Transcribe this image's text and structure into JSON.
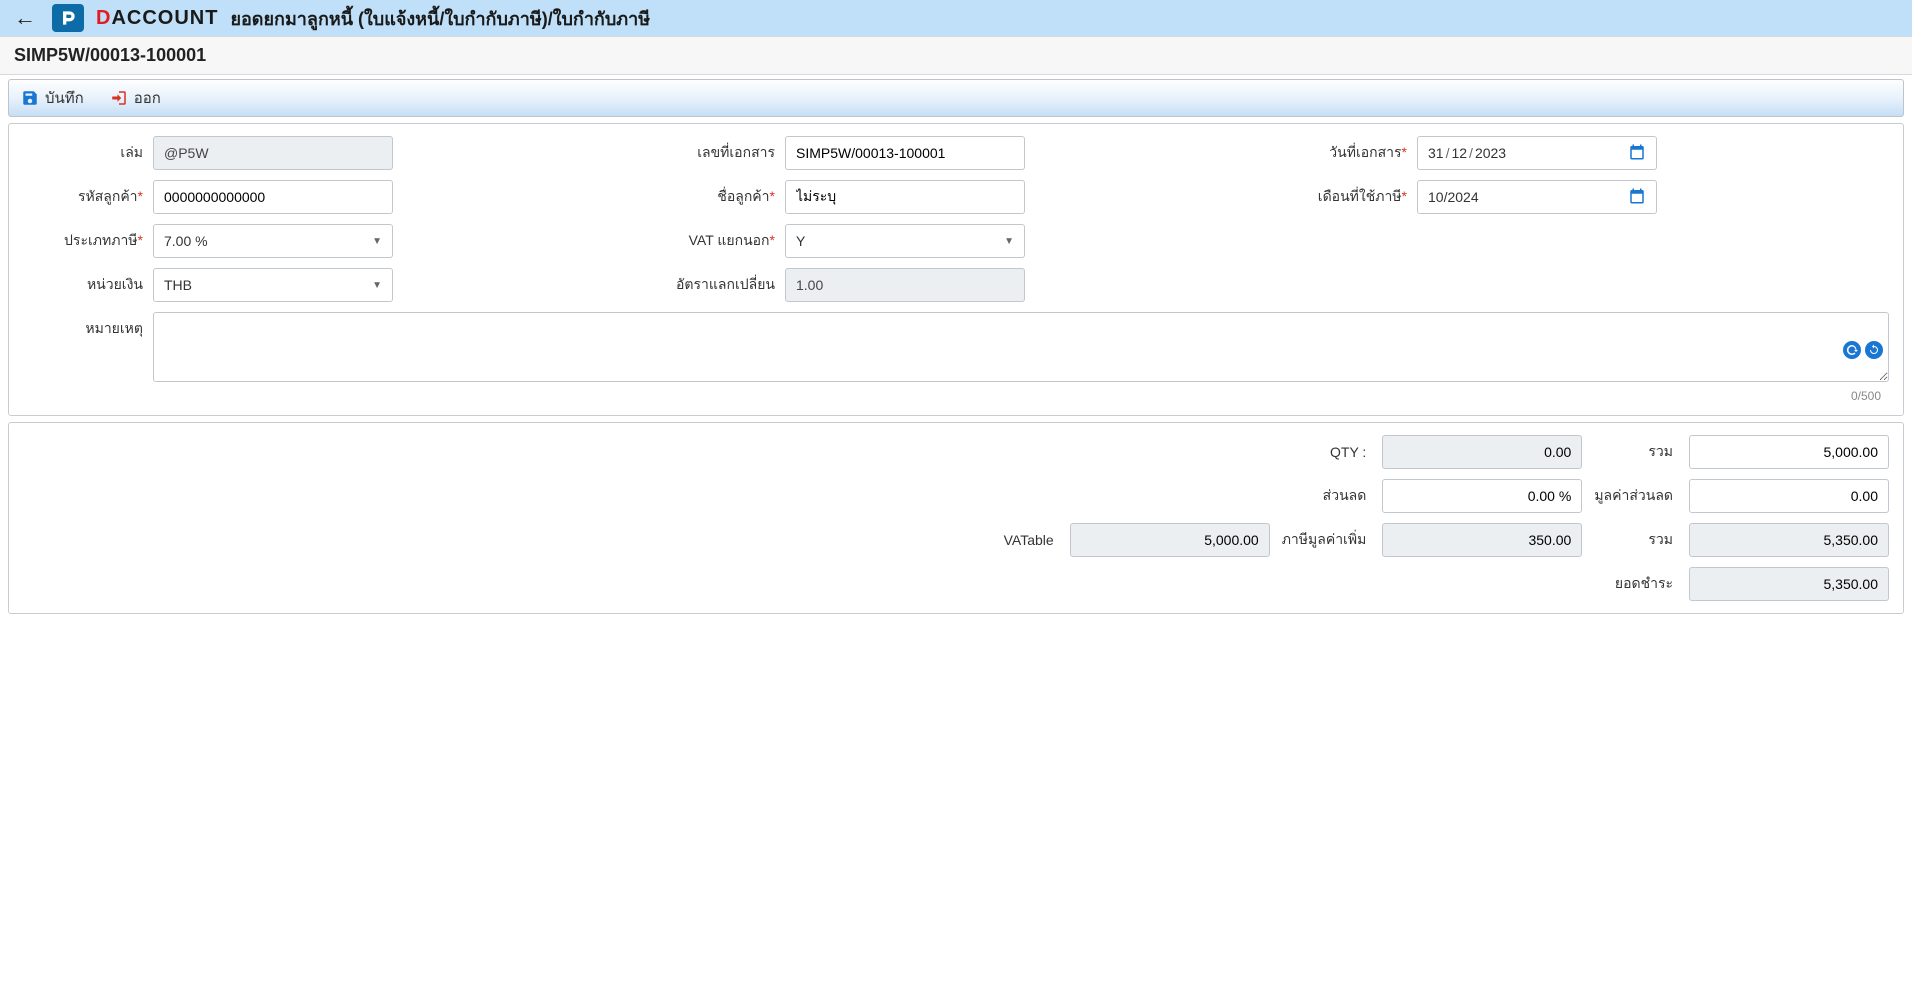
{
  "header": {
    "brand_d": "D",
    "brand_rest": "ACCOUNT",
    "page_title": "ยอดยกมาลูกหนี้ (ใบแจ้งหนี้/ใบกำกับภาษี)/ใบกำกับภาษี"
  },
  "sub_title": "SIMP5W/00013-100001",
  "toolbar": {
    "save_label": "บันทึก",
    "exit_label": "ออก"
  },
  "form": {
    "book_label": "เล่ม",
    "book_value": "@P5W",
    "docno_label": "เลขที่เอกสาร",
    "docno_value": "SIMP5W/00013-100001",
    "docdate_label": "วันที่เอกสาร",
    "docdate_day": "31",
    "docdate_mon": "12",
    "docdate_year": "2023",
    "custcode_label": "รหัสลูกค้า",
    "custcode_value": "0000000000000",
    "custname_label": "ชื่อลูกค้า",
    "custname_value": "ไม่ระบุ",
    "taxmonth_label": "เดือนที่ใช้ภาษี",
    "taxmonth_value": "10/2024",
    "taxtype_label": "ประเภทภาษี",
    "taxtype_value": "7.00 %",
    "vatsep_label": "VAT แยกนอก",
    "vatsep_value": "Y",
    "currency_label": "หน่วยเงิน",
    "currency_value": "THB",
    "rate_label": "อัตราแลกเปลี่ยน",
    "rate_value": "1.00",
    "remark_label": "หมายเหตุ",
    "remark_value": "",
    "char_counter": "0/500"
  },
  "totals": {
    "qty_label": "QTY :",
    "qty_value": "0.00",
    "total1_label": "รวม",
    "total1_value": "5,000.00",
    "discount_label": "ส่วนลด",
    "discount_value": "0.00 %",
    "discamount_label": "มูลค่าส่วนลด",
    "discamount_value": "0.00",
    "vatable_label": "VATable",
    "vatable_value": "5,000.00",
    "vat_label": "ภาษีมูลค่าเพิ่ม",
    "vat_value": "350.00",
    "total2_label": "รวม",
    "total2_value": "5,350.00",
    "net_label": "ยอดชำระ",
    "net_value": "5,350.00"
  }
}
